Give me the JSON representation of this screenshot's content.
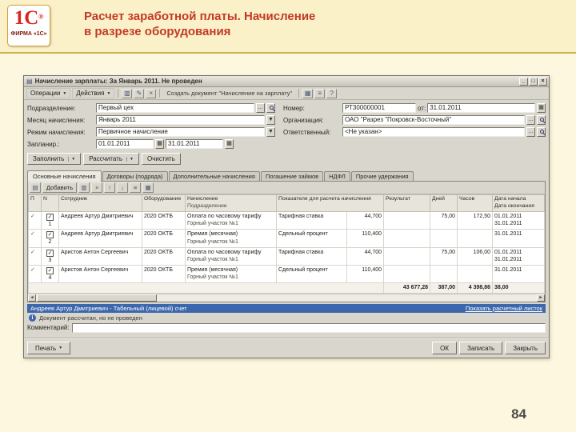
{
  "icons": {
    "dropdown": "▼",
    "ellipsis": "…",
    "calendar": "▦",
    "doc": "▤",
    "grid": "▤",
    "copy": "▥",
    "edit": "✎",
    "delete": "×",
    "up": "↑",
    "down": "↓",
    "sort": "≡",
    "help": "?",
    "check": "✓",
    "left": "◄",
    "right": "►",
    "info": "i",
    "min": "_",
    "max": "□",
    "close": "×",
    "row_marker": "✓"
  },
  "slide": {
    "logo_text": "1С",
    "logo_reg": "®",
    "logo_firm": "ФИРМА «1С»",
    "title_line1": "Расчет заработной платы. Начисление",
    "title_line2": "в разрезе оборудования",
    "page_number": "84"
  },
  "win": {
    "title": "Начисление зарплаты: За Январь 2011. Не проведен",
    "menu": {
      "operations": "Операции",
      "actions": "Действия",
      "hint": "Создать документ \"Начисление на зарплату\""
    },
    "form": {
      "department_label": "Подразделение:",
      "department_value": "Первый цех",
      "month_label": "Месяц начисления:",
      "month_value": "Январь 2011",
      "mode_label": "Режим начисления:",
      "mode_value": "Первичное начисление",
      "period_label": "Запланир.:",
      "period_from": "01.01.2011",
      "period_to": "31.01.2011",
      "number_label": "Номер:",
      "number_value": "РТ300000001",
      "date_label": "от:",
      "date_value": "31.01.2011",
      "org_label": "Организация:",
      "org_value": "ОАО \"Разрез \"Покровск-Восточный\"",
      "resp_label": "Ответственный:",
      "resp_value": "<Не указан>"
    },
    "actions_row": {
      "fill": "Заполнить",
      "calculate": "Рассчитать",
      "clear": "Очистить"
    },
    "tabs": [
      "Основные начисления",
      "Договоры (подряда)",
      "Дополнительные начисления",
      "Погашение займов",
      "НДФЛ",
      "Прочие удержания"
    ],
    "table": {
      "add_button": "Добавить",
      "head": {
        "marker": "П",
        "num": "N",
        "employee": "Сотрудник",
        "equipment": "Оборудование",
        "accrual": "Начисление",
        "department": "Подразделение",
        "indicators": "Показатели для расчета начисления",
        "result": "Результат",
        "days": "Дней",
        "hours": "Часов",
        "date_start": "Дата начала",
        "date_end": "Дата окончания"
      },
      "rows": [
        {
          "num": "1",
          "employee": "Андреев Артур Дмитриевич",
          "equipment": "2020 ОКТБ",
          "accrual": "Оплата по часовому тарифу",
          "department": "Горный участок №1",
          "indicator": "Тарифная ставка",
          "value": "44,700",
          "result": "",
          "days": "75,00",
          "hours": "172,50",
          "date_start": "01.01.2011",
          "date_end": "31.01.2011"
        },
        {
          "num": "2",
          "employee": "Андреев Артур Дмитриевич",
          "equipment": "2020 ОКТБ",
          "accrual": "Премия (месячная)",
          "department": "Горный участок №1",
          "indicator": "Сдельный процент",
          "value": "110,400",
          "result": "",
          "days": "",
          "hours": "",
          "date_start": "",
          "date_end": "31.01.2011"
        },
        {
          "num": "3",
          "employee": "Аристов Антон Сергеевич",
          "equipment": "2020 ОКТБ",
          "accrual": "Оплата по часовому тарифу",
          "department": "Горный участок №1",
          "indicator": "Тарифная ставка",
          "value": "44,700",
          "result": "",
          "days": "75,00",
          "hours": "106,00",
          "date_start": "01.01.2011",
          "date_end": "31.01.2011"
        },
        {
          "num": "4",
          "employee": "Аристов Антон Сергеевич",
          "equipment": "2020 ОКТБ",
          "accrual": "Премия (месячная)",
          "department": "Горный участок №1",
          "indicator": "Сдельный процент",
          "value": "110,400",
          "result": "",
          "days": "",
          "hours": "",
          "date_start": "",
          "date_end": "31.01.2011"
        }
      ],
      "totals": {
        "result": "43 677,28",
        "days": "387,00",
        "hours": "4 398,86",
        "extra": "38,00"
      }
    },
    "selection_bar": {
      "info": "Андреев Артур Дмитриевич - Табельный (лицевой) счет",
      "link": "Показать расчетный листок"
    },
    "doc_status": "Документ рассчитан, но не проведен",
    "comment_label": "Комментарий:",
    "comment_value": "",
    "footer": {
      "print": "Печать",
      "ok": "ОК",
      "save": "Записать",
      "close": "Закрыть"
    }
  }
}
